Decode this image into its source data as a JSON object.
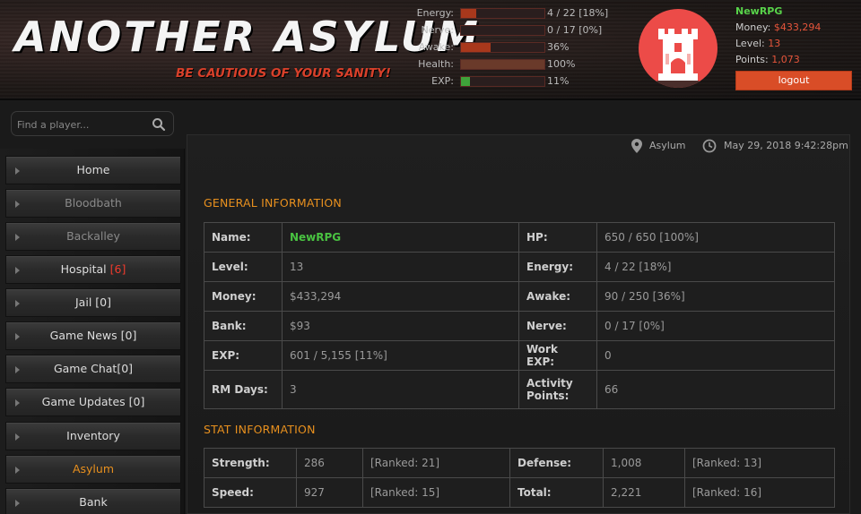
{
  "header": {
    "logo_title": "ANOTHER ASYLUM",
    "tagline": "BE CAUTIOUS OF YOUR SANITY!",
    "bars": [
      {
        "label": "Energy:",
        "value": "4 / 22 [18%]",
        "percent": 18
      },
      {
        "label": "Nerve:",
        "value": "0 / 17 [0%]",
        "percent": 0
      },
      {
        "label": "Awake:",
        "value": "36%",
        "percent": 36
      },
      {
        "label": "Health:",
        "value": "100%",
        "percent": 100
      },
      {
        "label": "EXP:",
        "value": "11%",
        "percent": 11
      }
    ],
    "avatar_icon": "castle-tower-icon",
    "user": {
      "name": "NewRPG",
      "money_label": "Money:",
      "money": "$433,294",
      "level_label": "Level:",
      "level": "13",
      "points_label": "Points:",
      "points": "1,073"
    },
    "logout_label": "logout"
  },
  "search": {
    "placeholder": "Find a player..."
  },
  "sidebar": {
    "items": [
      {
        "label": "Home",
        "badge": ""
      },
      {
        "label": "Bloodbath",
        "badge": ""
      },
      {
        "label": "Backalley",
        "badge": ""
      },
      {
        "label": "Hospital ",
        "badge": "[6]"
      },
      {
        "label": "Jail [0]",
        "badge": ""
      },
      {
        "label": "Game News [0]",
        "badge": ""
      },
      {
        "label": "Game Chat[0]",
        "badge": ""
      },
      {
        "label": "Game Updates [0]",
        "badge": ""
      },
      {
        "label": "Inventory",
        "badge": ""
      },
      {
        "label": "Asylum",
        "badge": ""
      },
      {
        "label": "Bank",
        "badge": ""
      }
    ]
  },
  "main": {
    "location": "Asylum",
    "datetime": "May 29, 2018 9:42:28pm",
    "general_title": "GENERAL INFORMATION",
    "general": [
      [
        "Name:",
        "NewRPG",
        "HP:",
        "650 / 650 [100%]"
      ],
      [
        "Level:",
        "13",
        "Energy:",
        "4 / 22 [18%]"
      ],
      [
        "Money:",
        "$433,294",
        "Awake:",
        "90 / 250 [36%]"
      ],
      [
        "Bank:",
        "$93",
        "Nerve:",
        "0 / 17 [0%]"
      ],
      [
        "EXP:",
        "601 / 5,155 [11%]",
        "Work EXP:",
        "0"
      ],
      [
        "RM Days:",
        "3",
        "Activity Points:",
        "66"
      ]
    ],
    "stat_title": "STAT INFORMATION",
    "stats": [
      [
        "Strength:",
        "286",
        "[Ranked: 21]",
        "Defense:",
        "1,008",
        "[Ranked: 13]"
      ],
      [
        "Speed:",
        "927",
        "[Ranked: 15]",
        "Total:",
        "2,221",
        "[Ranked: 16]"
      ]
    ]
  },
  "colors": {
    "accent_orange": "#e8901e",
    "alert_red": "#ef3b2d",
    "money_red": "#e6553b",
    "name_green": "#49c241",
    "logout_bg": "#d94d27",
    "avatar_bg": "#ec4b48"
  }
}
